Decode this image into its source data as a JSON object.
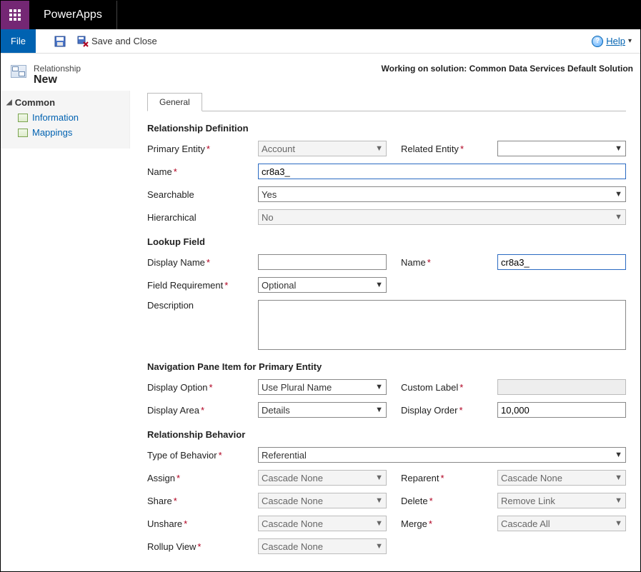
{
  "topbar": {
    "brand": "PowerApps"
  },
  "toolbar": {
    "file_label": "File",
    "save_and_close_label": "Save and Close",
    "help_label": "Help"
  },
  "pagehead": {
    "entity_type": "Relationship",
    "entity_state": "New",
    "solution_line": "Working on solution: Common Data Services Default Solution"
  },
  "sidebar": {
    "group_label": "Common",
    "items": [
      {
        "label": "Information"
      },
      {
        "label": "Mappings"
      }
    ]
  },
  "tabs": {
    "general": "General"
  },
  "sections": {
    "rel_def_title": "Relationship Definition",
    "lookup_title": "Lookup Field",
    "navpane_title": "Navigation Pane Item for Primary Entity",
    "behavior_title": "Relationship Behavior"
  },
  "rel_def": {
    "primary_entity_label": "Primary Entity",
    "primary_entity_value": "Account",
    "related_entity_label": "Related Entity",
    "related_entity_value": "",
    "name_label": "Name",
    "name_value": "cr8a3_",
    "searchable_label": "Searchable",
    "searchable_value": "Yes",
    "hierarchical_label": "Hierarchical",
    "hierarchical_value": "No"
  },
  "lookup": {
    "display_name_label": "Display Name",
    "display_name_value": "",
    "name_label": "Name",
    "name_value": "cr8a3_",
    "field_req_label": "Field Requirement",
    "field_req_value": "Optional",
    "description_label": "Description",
    "description_value": ""
  },
  "navpane": {
    "display_option_label": "Display Option",
    "display_option_value": "Use Plural Name",
    "custom_label_label": "Custom Label",
    "custom_label_value": "",
    "display_area_label": "Display Area",
    "display_area_value": "Details",
    "display_order_label": "Display Order",
    "display_order_value": "10,000"
  },
  "behavior": {
    "type_label": "Type of Behavior",
    "type_value": "Referential",
    "assign_label": "Assign",
    "assign_value": "Cascade None",
    "reparent_label": "Reparent",
    "reparent_value": "Cascade None",
    "share_label": "Share",
    "share_value": "Cascade None",
    "delete_label": "Delete",
    "delete_value": "Remove Link",
    "unshare_label": "Unshare",
    "unshare_value": "Cascade None",
    "merge_label": "Merge",
    "merge_value": "Cascade All",
    "rollup_label": "Rollup View",
    "rollup_value": "Cascade None"
  }
}
